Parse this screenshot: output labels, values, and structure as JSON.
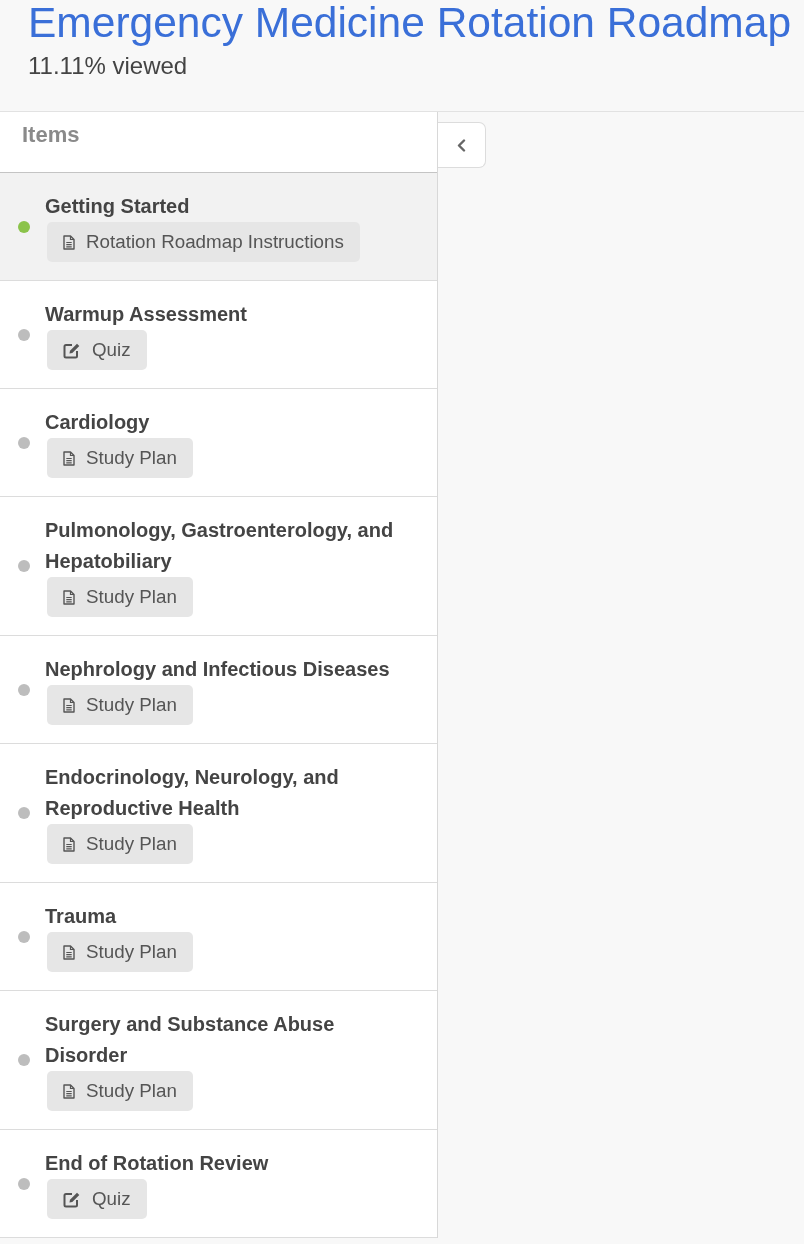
{
  "header": {
    "title": "Emergency Medicine Rotation Roadmap",
    "progress": "11.11% viewed"
  },
  "sidebar": {
    "heading": "Items"
  },
  "items": [
    {
      "title": "Getting Started",
      "selected": true,
      "viewed": true,
      "resource": {
        "kind": "document",
        "label": "Rotation Roadmap Instructions"
      }
    },
    {
      "title": "Warmup Assessment",
      "selected": false,
      "viewed": false,
      "resource": {
        "kind": "quiz",
        "label": "Quiz"
      }
    },
    {
      "title": "Cardiology",
      "selected": false,
      "viewed": false,
      "resource": {
        "kind": "document",
        "label": "Study Plan"
      }
    },
    {
      "title": "Pulmonology, Gastroenterology, and Hepatobiliary",
      "selected": false,
      "viewed": false,
      "resource": {
        "kind": "document",
        "label": "Study Plan"
      }
    },
    {
      "title": "Nephrology and Infectious Diseases",
      "selected": false,
      "viewed": false,
      "resource": {
        "kind": "document",
        "label": "Study Plan"
      }
    },
    {
      "title": "Endocrinology, Neurology, and Reproductive Health",
      "selected": false,
      "viewed": false,
      "resource": {
        "kind": "document",
        "label": "Study Plan"
      }
    },
    {
      "title": "Trauma",
      "selected": false,
      "viewed": false,
      "resource": {
        "kind": "document",
        "label": "Study Plan"
      }
    },
    {
      "title": "Surgery and Substance Abuse Disorder",
      "selected": false,
      "viewed": false,
      "resource": {
        "kind": "document",
        "label": "Study Plan"
      }
    },
    {
      "title": "End of Rotation Review",
      "selected": false,
      "viewed": false,
      "resource": {
        "kind": "quiz",
        "label": "Quiz"
      }
    }
  ]
}
